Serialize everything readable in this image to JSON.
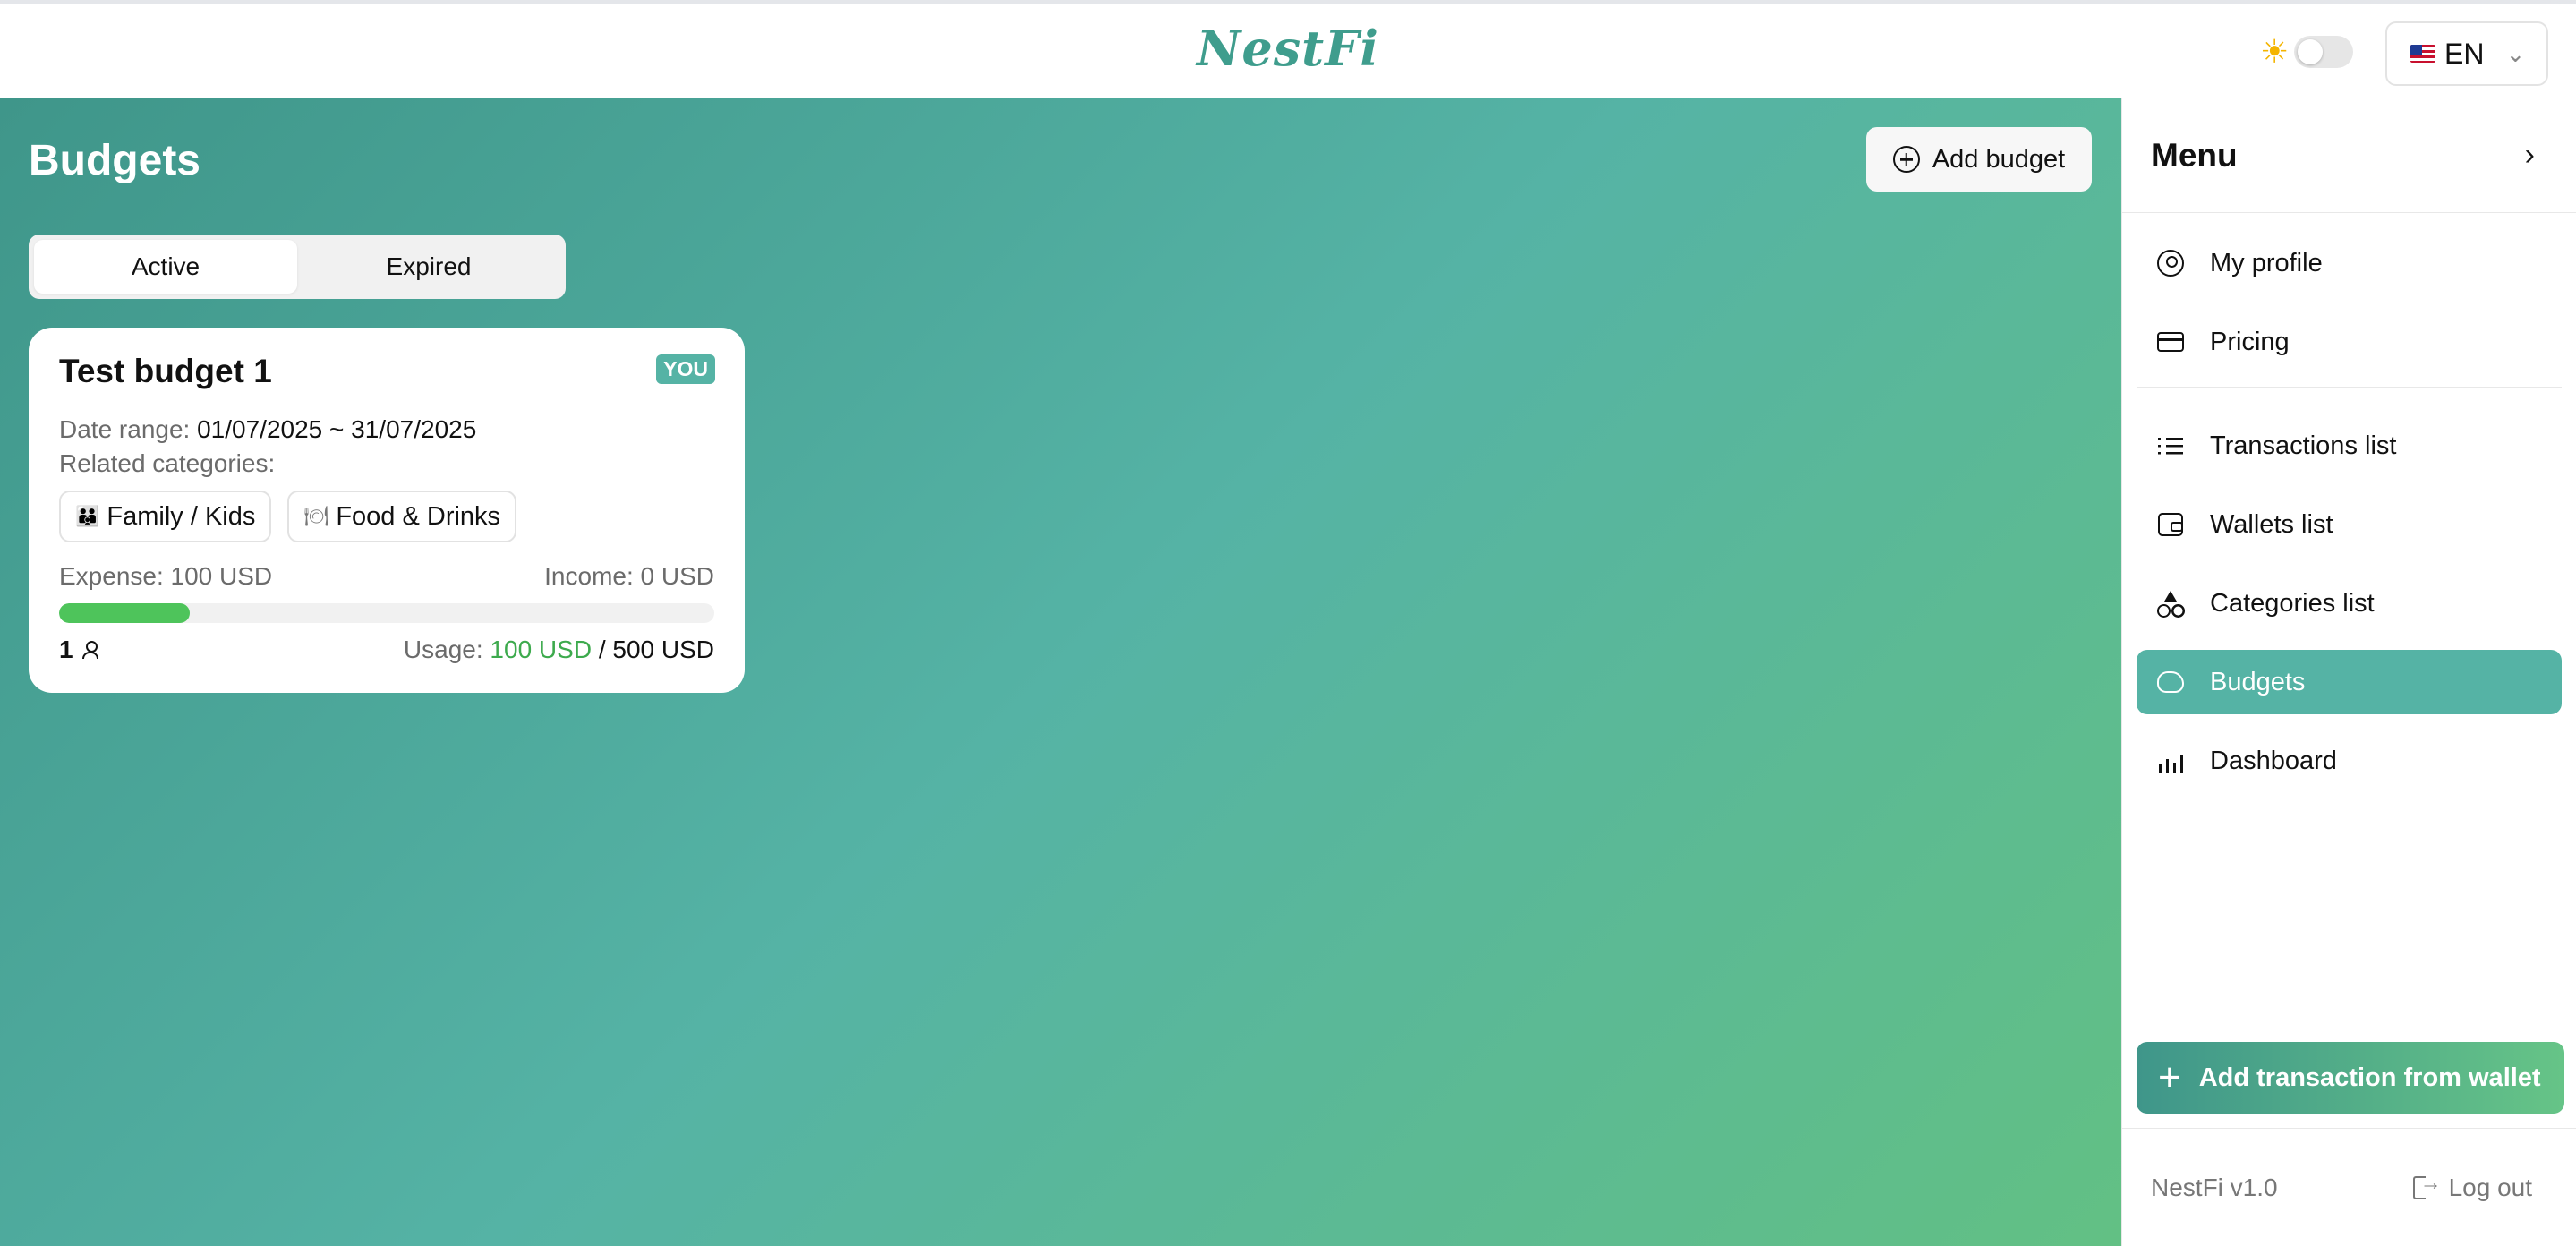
{
  "header": {
    "brand": "NestFi",
    "theme_icon": "sun-icon",
    "language": {
      "flag": "us-flag-icon",
      "label": "EN"
    }
  },
  "main": {
    "title": "Budgets",
    "add_budget_label": "Add budget",
    "tabs": [
      {
        "label": "Active",
        "selected": true
      },
      {
        "label": "Expired",
        "selected": false
      }
    ],
    "budget_card": {
      "title": "Test budget 1",
      "owner_badge": "YOU",
      "date_range_label": "Date range:",
      "date_range_value": "01/07/2025 ~ 31/07/2025",
      "related_label": "Related categories:",
      "categories": [
        {
          "icon": "family-icon",
          "label": "Family / Kids"
        },
        {
          "icon": "plate-icon",
          "label": "Food & Drinks"
        }
      ],
      "expense": "Expense: 100 USD",
      "income": "Income: 0 USD",
      "usage_fraction": 0.2,
      "members_count": "1",
      "usage_label": "Usage:",
      "usage_used": "100 USD",
      "usage_total": "/ 500 USD"
    }
  },
  "sidebar": {
    "title": "Menu",
    "group1": [
      {
        "label": "My profile",
        "icon": "user-circle-icon"
      },
      {
        "label": "Pricing",
        "icon": "credit-card-icon"
      }
    ],
    "group2": [
      {
        "label": "Transactions list",
        "icon": "list-icon"
      },
      {
        "label": "Wallets list",
        "icon": "wallet-icon"
      },
      {
        "label": "Categories list",
        "icon": "shapes-icon"
      },
      {
        "label": "Budgets",
        "icon": "piggy-bank-icon",
        "active": true
      },
      {
        "label": "Dashboard",
        "icon": "bar-chart-icon"
      }
    ],
    "add_transaction_label": "Add transaction from wallet",
    "version": "NestFi v1.0",
    "logout_label": "Log out"
  },
  "colors": {
    "brand": "#3f9d8d",
    "accent": "#55b3a5",
    "progress": "#4ec45b",
    "usage_used": "#3daa4d"
  }
}
